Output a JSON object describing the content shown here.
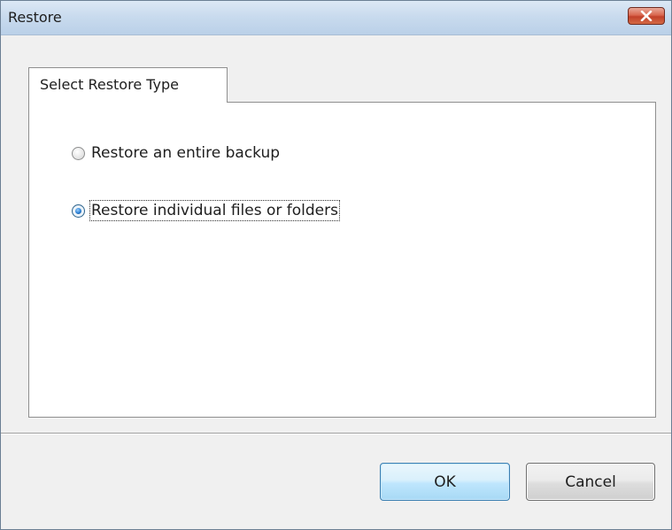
{
  "window": {
    "title": "Restore"
  },
  "tabs": [
    {
      "label": "Select Restore Type",
      "selected": true
    }
  ],
  "restore_options": [
    {
      "label": "Restore an entire backup",
      "checked": false
    },
    {
      "label": "Restore individual files or folders",
      "checked": true,
      "focused": true
    }
  ],
  "buttons": {
    "ok_label": "OK",
    "cancel_label": "Cancel"
  },
  "icons": {
    "close": "close-icon"
  },
  "colors": {
    "close_button": "#c2402a",
    "default_button_border": "#3c7fb1",
    "radio_selected": "#2a7fd4"
  }
}
